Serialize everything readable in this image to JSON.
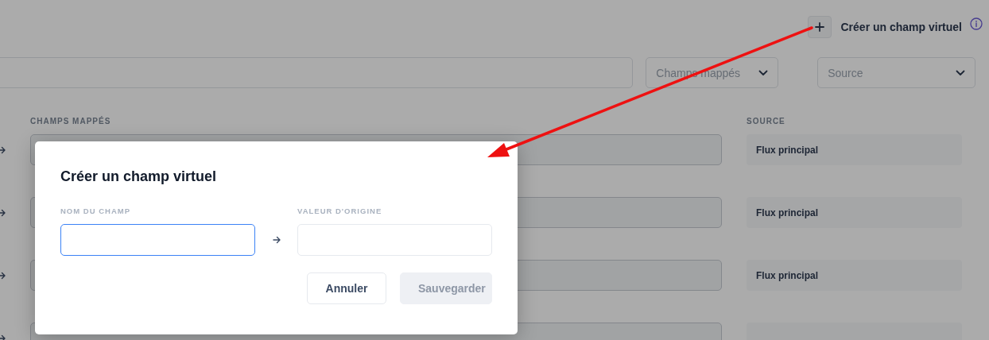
{
  "header": {
    "create_action": {
      "label": "Créer un champ virtuel"
    }
  },
  "filters": {
    "dropdowns": [
      {
        "placeholder": "Champs mappés"
      },
      {
        "placeholder": "Source"
      }
    ]
  },
  "table": {
    "columns": [
      "CHAMPS MAPPÉS",
      "SOURCE"
    ],
    "rows": [
      {
        "kind": "full",
        "source": "Flux principal"
      },
      {
        "kind": "full",
        "source": "Flux principal"
      },
      {
        "kind": "full",
        "source": "Flux principal"
      },
      {
        "kind": "cut"
      }
    ]
  },
  "modal": {
    "title": "Créer un champ virtuel",
    "fields": [
      {
        "label": "NOM DU CHAMP",
        "focused": true
      },
      {
        "label": "VALEUR D'ORIGINE",
        "focused": false
      }
    ],
    "buttons": [
      {
        "label": "Annuler",
        "kind": "secondary",
        "disabled": false
      },
      {
        "label": "Sauvegarder",
        "kind": "primary",
        "disabled": true
      }
    ]
  }
}
